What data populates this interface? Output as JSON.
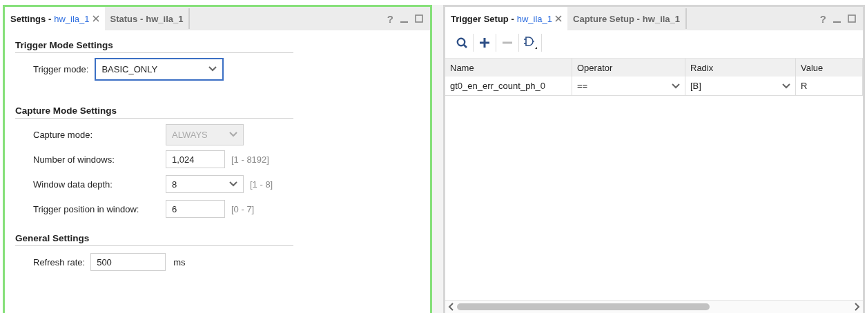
{
  "settings_panel": {
    "tabs": [
      {
        "label": "Settings -",
        "target": "hw_ila_1",
        "selected": true,
        "closable": true
      },
      {
        "label": "Status -",
        "target": "hw_ila_1",
        "selected": false,
        "closable": false
      }
    ],
    "help": "?",
    "focused": true,
    "sections": [
      {
        "title": "Trigger Mode Settings",
        "rows": [
          {
            "kind": "select",
            "label": "Trigger mode:",
            "value": "BASIC_ONLY",
            "focused": true,
            "disabled": false
          }
        ]
      },
      {
        "title": "Capture Mode Settings",
        "rows": [
          {
            "kind": "select",
            "label": "Capture mode:",
            "value": "ALWAYS",
            "focused": false,
            "disabled": true
          },
          {
            "kind": "input",
            "label": "Number of windows:",
            "value": "1,024",
            "range": "[1 - 8192]"
          },
          {
            "kind": "select",
            "label": "Window data depth:",
            "value": "8",
            "range": "[1 - 8]",
            "focused": false,
            "disabled": false
          },
          {
            "kind": "input",
            "label": "Trigger position in window:",
            "value": "6",
            "range": "[0 - 7]"
          }
        ]
      },
      {
        "title": "General Settings",
        "rows": [
          {
            "kind": "input",
            "label": "Refresh rate:",
            "value": "500",
            "unit": "ms"
          }
        ]
      }
    ]
  },
  "trigger_panel": {
    "tabs": [
      {
        "label": "Trigger Setup -",
        "target": "hw_ila_1",
        "selected": true,
        "closable": true
      },
      {
        "label": "Capture Setup -",
        "target": "hw_ila_1",
        "selected": false,
        "closable": false
      }
    ],
    "help": "?",
    "focused": false,
    "toolbar": [
      {
        "kind": "search",
        "disabled": false
      },
      {
        "kind": "add",
        "disabled": false
      },
      {
        "kind": "remove",
        "disabled": true
      },
      {
        "kind": "gate",
        "disabled": false
      }
    ],
    "table": {
      "columns": [
        "Name",
        "Operator",
        "Radix",
        "Value"
      ],
      "rows": [
        {
          "name": "gt0_en_err_count_ph_0",
          "operator": "==",
          "radix": "[B]",
          "value": "R"
        }
      ]
    }
  }
}
